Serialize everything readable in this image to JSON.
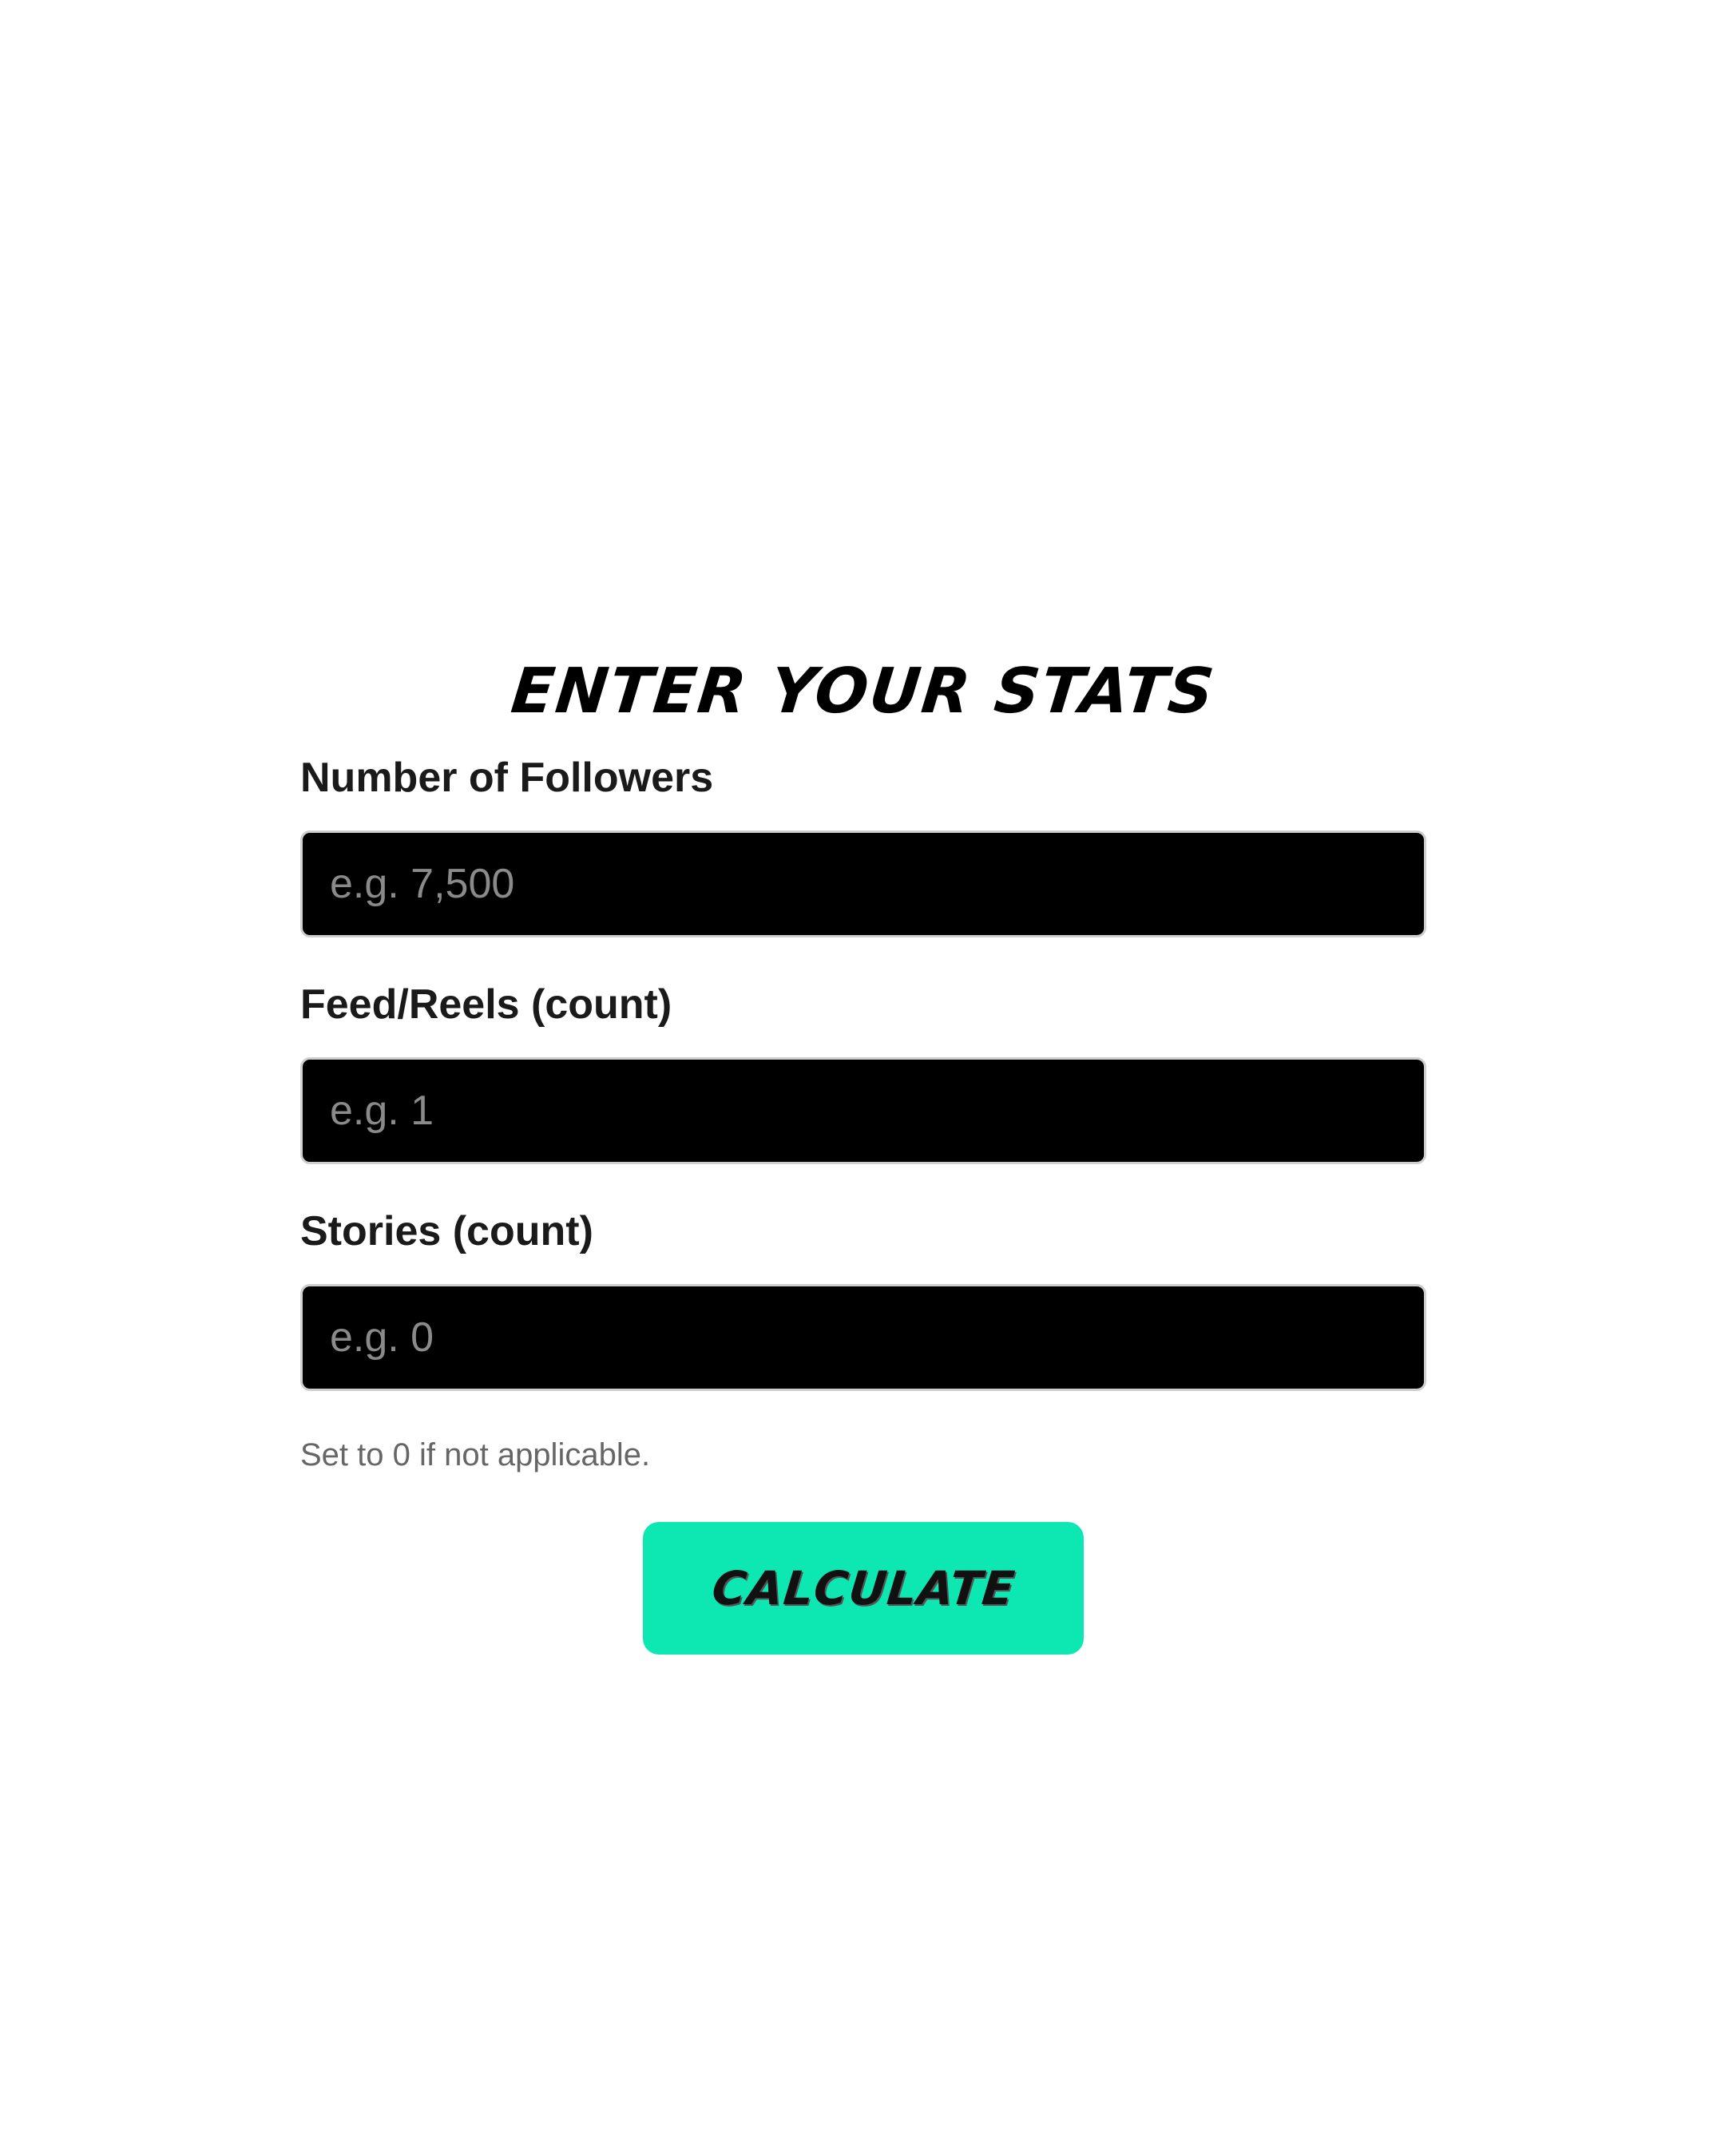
{
  "form": {
    "title": "ENTER YOUR STATS",
    "fields": [
      {
        "label": "Number of Followers",
        "placeholder": "e.g. 7,500",
        "value": ""
      },
      {
        "label": "Feed/Reels (count)",
        "placeholder": "e.g. 1",
        "value": ""
      },
      {
        "label": "Stories (count)",
        "placeholder": "e.g. 0",
        "value": ""
      }
    ],
    "help_text": "Set to 0 if not applicable.",
    "submit_label": "CALCULATE"
  },
  "colors": {
    "accent": "#0de8b3",
    "input_background": "#000000",
    "input_border": "#cfcfcf",
    "label_text": "#1a1a1a",
    "help_text": "#666666"
  }
}
